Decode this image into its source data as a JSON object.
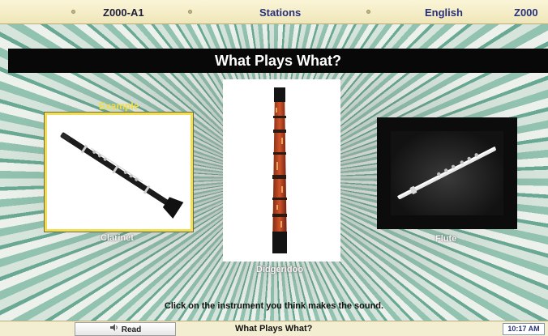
{
  "topbar": {
    "activity_id": "Z000-A1",
    "stations": "Stations",
    "language": "English",
    "zoo": "Z000"
  },
  "activity": {
    "title": "What Plays What?",
    "example_label": "Example",
    "instruction": "Click on the instrument you think makes the sound."
  },
  "instruments": [
    {
      "name": "Clarinet",
      "is_example": true
    },
    {
      "name": "Didgeridoo",
      "is_example": false
    },
    {
      "name": "Flute",
      "is_example": false
    }
  ],
  "bottombar": {
    "read_label": "Read",
    "title": "What Plays What?",
    "time": "10:17 AM"
  },
  "colors": {
    "topbar_text": "#27307a",
    "example_highlight": "#f0df55",
    "title_bg": "#080808"
  },
  "icons": {
    "read": "read-aloud-icon"
  }
}
